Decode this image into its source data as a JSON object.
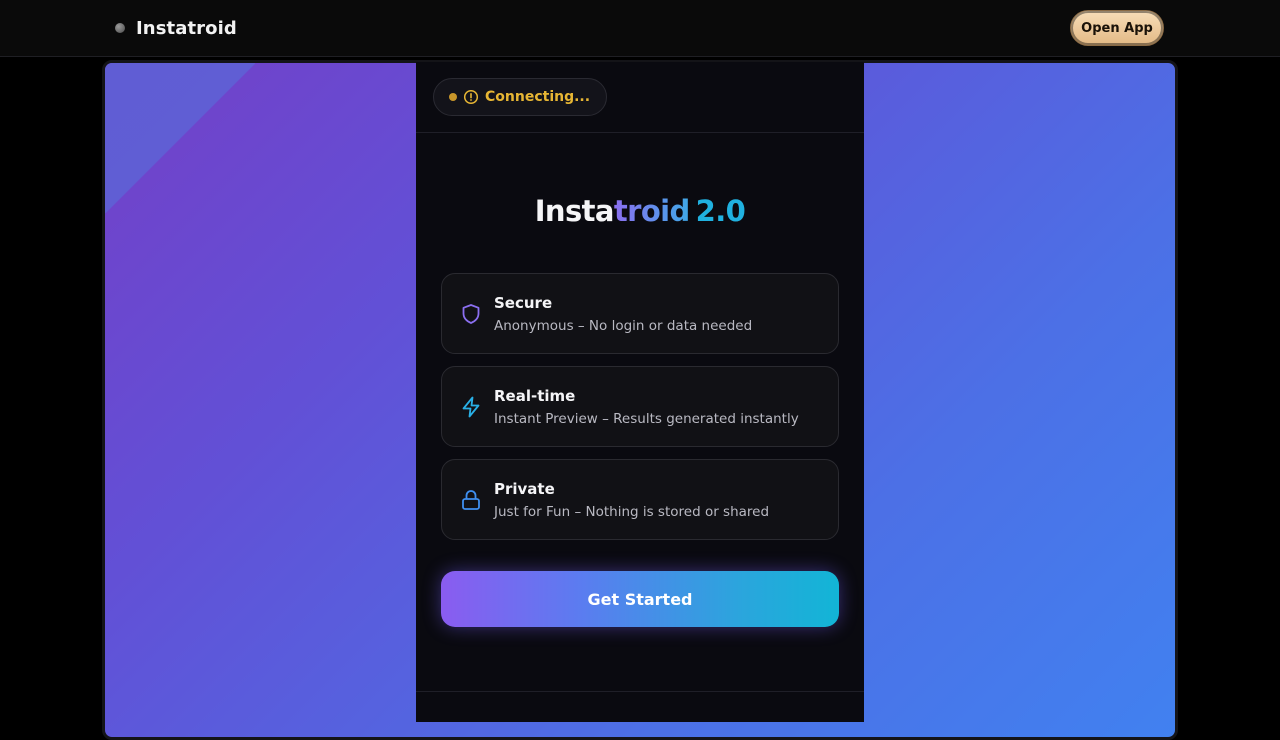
{
  "nav": {
    "brand": "Instatroid",
    "open_app_label": "Open App"
  },
  "status": {
    "text": "Connecting...",
    "color": "#e7b634"
  },
  "hero": {
    "title_part_a": "Insta",
    "title_part_b": "troid",
    "title_version": "2.0"
  },
  "features": [
    {
      "icon": "shield-icon",
      "title": "Secure",
      "description": "Anonymous – No login or data needed",
      "color": "#8b6ff0"
    },
    {
      "icon": "lightning-icon",
      "title": "Real-time",
      "description": "Instant Preview – Results generated instantly",
      "color": "#29b0e6"
    },
    {
      "icon": "lock-icon",
      "title": "Private",
      "description": "Just for Fun – Nothing is stored or shared",
      "color": "#3f8ff0"
    }
  ],
  "cta": {
    "label": "Get Started"
  },
  "colors": {
    "accent_purple": "#8a5cf0",
    "accent_cyan": "#12b5d6",
    "panel_bg": "#0a0a10",
    "button_gold": "#e3b985"
  }
}
